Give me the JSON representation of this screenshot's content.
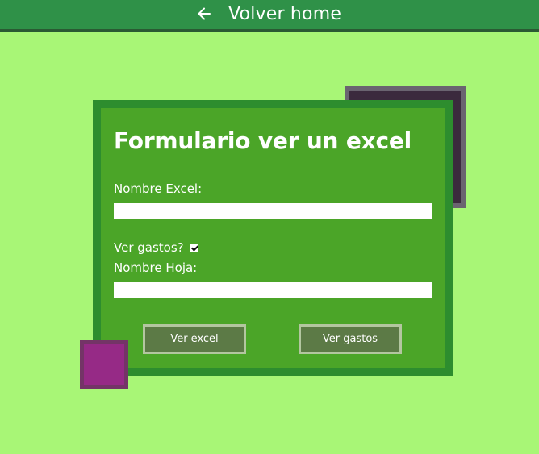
{
  "header": {
    "back_label": "Volver home",
    "back_icon": "arrow-left-icon"
  },
  "form": {
    "title": "Formulario ver un excel",
    "excel_label": "Nombre Excel:",
    "excel_value": "",
    "gastos_label": "Ver gastos?",
    "gastos_checked": true,
    "hoja_label": "Nombre Hoja:",
    "hoja_value": "",
    "btn_ver_excel": "Ver excel",
    "btn_ver_gastos": "Ver gastos"
  },
  "colors": {
    "page_bg": "#a8f676",
    "topbar_bg": "#2f9148",
    "card_bg": "#4ba528",
    "card_border": "#2d8d2e",
    "button_bg": "#5c7a46",
    "deco_dark": "#3b2a3d",
    "deco_purple": "#962a86"
  }
}
